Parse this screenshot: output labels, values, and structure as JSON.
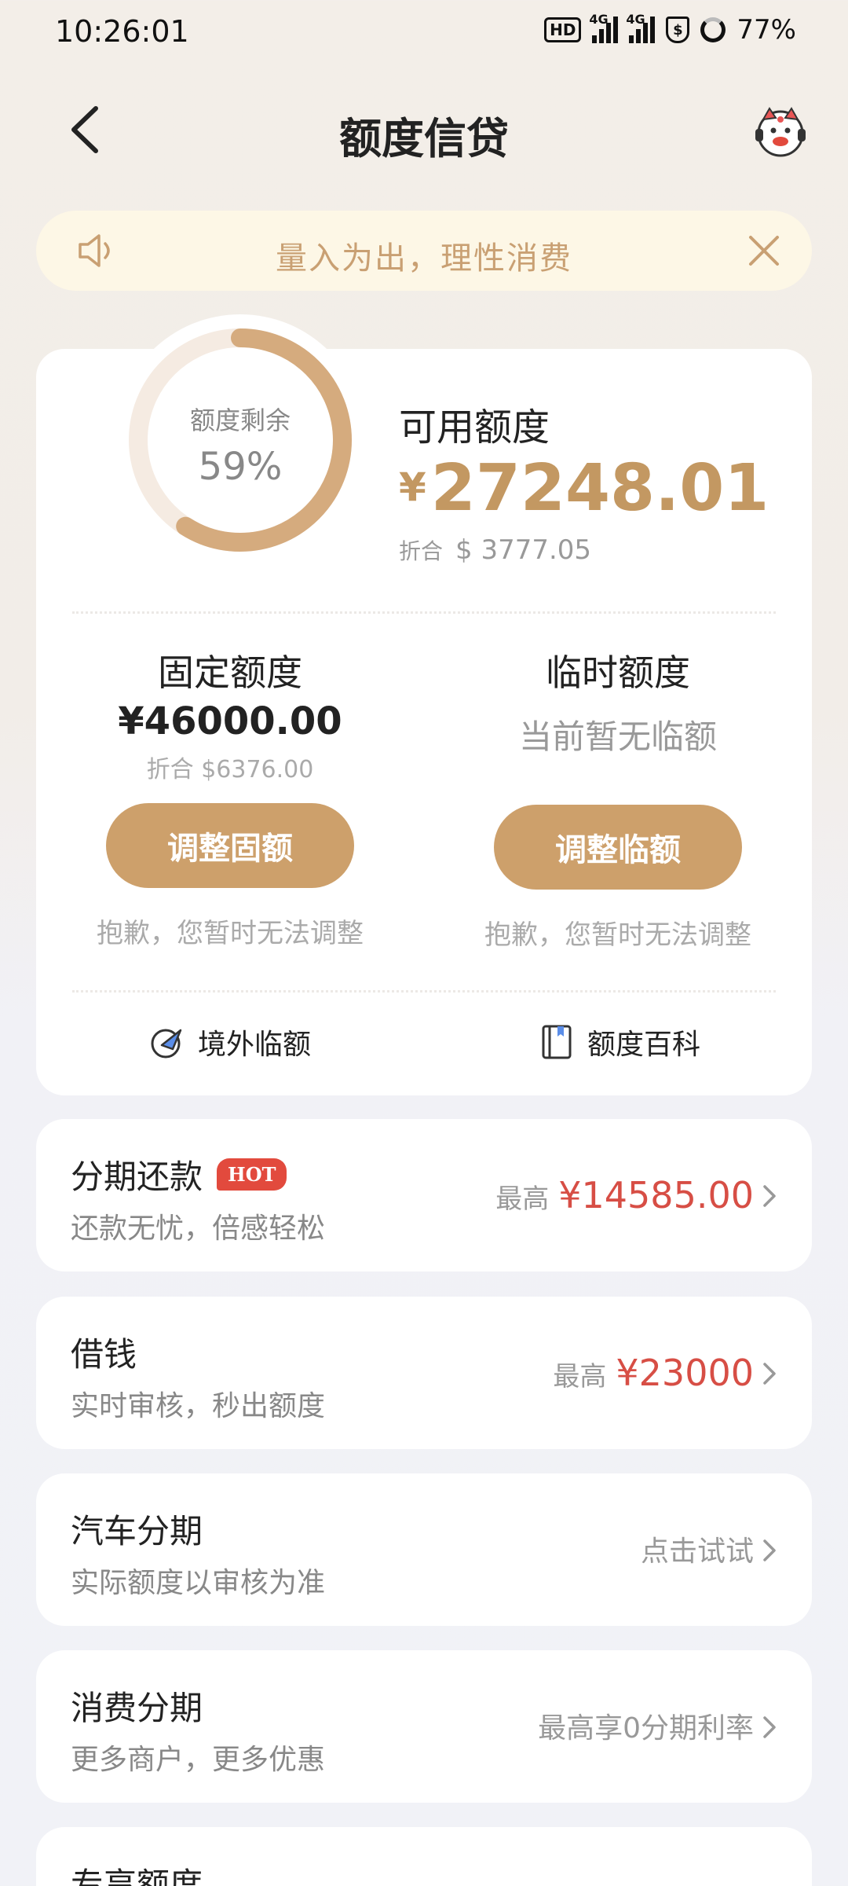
{
  "status_bar": {
    "time": "10:26:01",
    "hd": "HD",
    "net1": "4G",
    "net2": "4G",
    "shield_symbol": "$",
    "battery": "77%"
  },
  "header": {
    "title": "额度信贷",
    "back_icon": "chevron-left-icon",
    "mascot_icon": "mascot-icon"
  },
  "notice": {
    "text": "量入为出，理性消费",
    "icon": "speaker-icon",
    "close_icon": "close-icon"
  },
  "credit": {
    "ring_label": "额度剩余",
    "ring_value": "59%",
    "ring_fraction": 0.59,
    "available_label": "可用额度",
    "currency_symbol": "¥",
    "available_amount": "27248.01",
    "converted_prefix": "折合",
    "converted_value": "$ 3777.05",
    "fixed": {
      "title": "固定额度",
      "amount": "¥46000.00",
      "converted": "折合 $6376.00",
      "button": "调整固额",
      "note": "抱歉，您暂时无法调整"
    },
    "temp": {
      "title": "临时额度",
      "none_text": "当前暂无临额",
      "button": "调整临额",
      "note": "抱歉，您暂时无法调整"
    },
    "link_overseas": "境外临额",
    "link_wiki": "额度百科",
    "accent_color": "#cda06b",
    "amount_color": "#c39862"
  },
  "services": [
    {
      "title": "分期还款",
      "badge": "HOT",
      "subtitle": "还款无忧，倍感轻松",
      "prefix": "最高",
      "amount": "¥14585.00"
    },
    {
      "title": "借钱",
      "subtitle": "实时审核，秒出额度",
      "prefix": "最高",
      "amount": "¥23000"
    },
    {
      "title": "汽车分期",
      "subtitle": "实际额度以审核为准",
      "action": "点击试试"
    },
    {
      "title": "消费分期",
      "subtitle": "更多商户，更多优惠",
      "action": "最高享0分期利率"
    },
    {
      "title": "专享额度"
    }
  ],
  "colors": {
    "price_red": "#d74e45",
    "hot_badge": "#e24a3d"
  }
}
